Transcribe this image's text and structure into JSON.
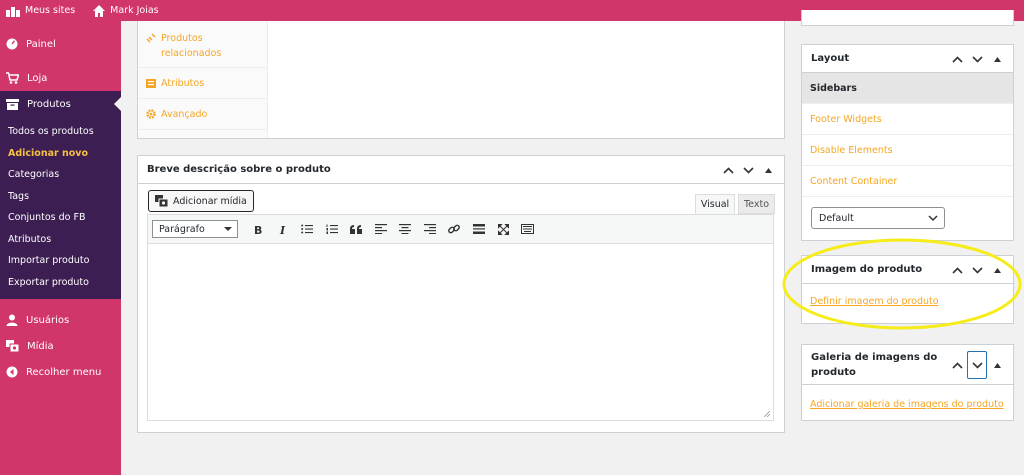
{
  "adminbar": {
    "sites": "Meus sites",
    "site_name": "Mark Joias"
  },
  "menu": {
    "painel": "Painel",
    "loja": "Loja",
    "produtos": "Produtos",
    "submenu": [
      "Todos os produtos",
      "Adicionar novo",
      "Categorias",
      "Tags",
      "Conjuntos do FB",
      "Atributos",
      "Importar produto",
      "Exportar produto"
    ],
    "usuarios": "Usuários",
    "midia": "Mídia",
    "recolher": "Recolher menu"
  },
  "product_data": {
    "tabs": [
      "Produtos relacionados",
      "Atributos",
      "Avançado"
    ]
  },
  "short_description": {
    "title": "Breve descrição sobre o produto",
    "add_media": "Adicionar mídia",
    "tab_visual": "Visual",
    "tab_text": "Texto",
    "format": "Parágrafo"
  },
  "layout_box": {
    "title": "Layout",
    "items": [
      "Sidebars",
      "Footer Widgets",
      "Disable Elements",
      "Content Container"
    ],
    "select_value": "Default"
  },
  "image_box": {
    "title": "Imagem do produto",
    "link": "Definir imagem do produto"
  },
  "gallery_box": {
    "title": "Galeria de imagens do produto",
    "link": "Adicionar galeria de imagens do produto"
  },
  "colors": {
    "admin_pink": "#d0366a",
    "menu_purple": "#3d1e52",
    "link_orange": "#f6a623",
    "highlight_yellow": "#f5ec1a"
  }
}
